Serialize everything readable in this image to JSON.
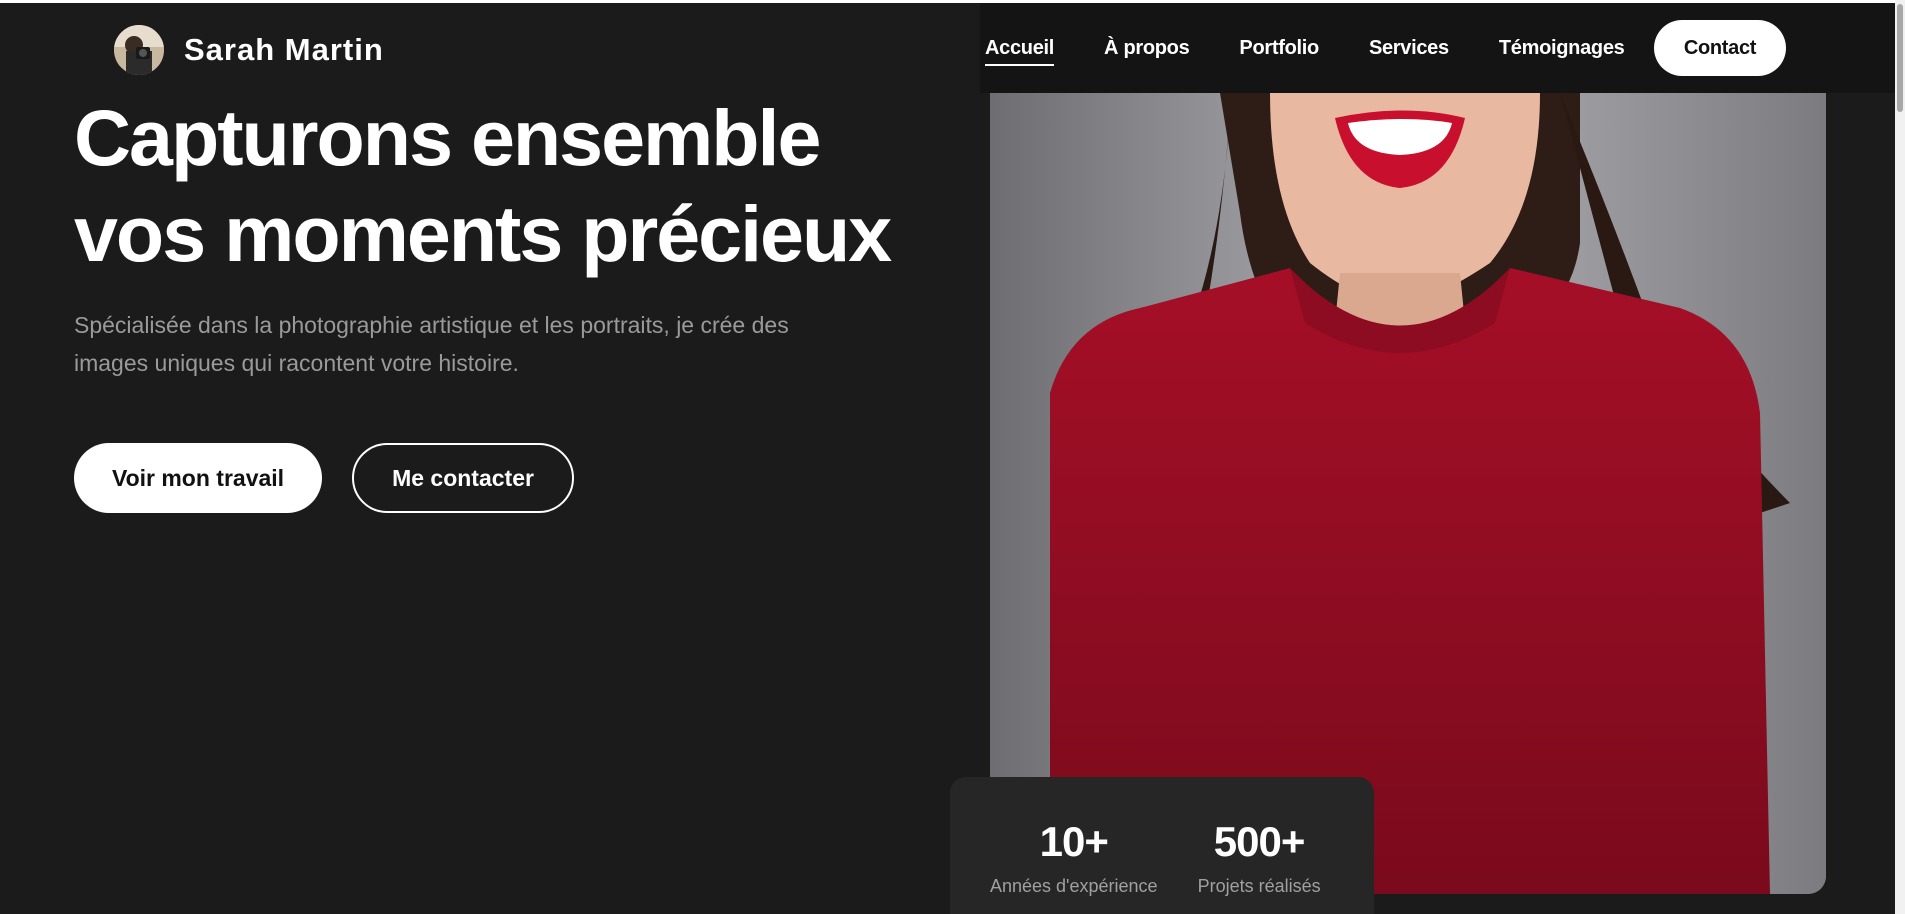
{
  "brand": {
    "name": "Sarah Martin",
    "avatar_icon": "camera-photographer-avatar"
  },
  "nav": {
    "items": [
      {
        "label": "Accueil",
        "active": true
      },
      {
        "label": "À propos"
      },
      {
        "label": "Portfolio"
      },
      {
        "label": "Services"
      },
      {
        "label": "Témoignages"
      }
    ],
    "contact_label": "Contact"
  },
  "hero": {
    "title_line1": "Capturons ensemble",
    "title_line2": "vos moments précieux",
    "subtitle_line1": "Spécialisée dans la photographie artistique et les portraits, je crée des",
    "subtitle_line2": "images uniques qui racontent votre histoire.",
    "primary_button": "Voir mon travail",
    "secondary_button": "Me contacter"
  },
  "stats": [
    {
      "value": "10+",
      "label": "Années d'expérience"
    },
    {
      "value": "500+",
      "label": "Projets réalisés"
    }
  ],
  "colors": {
    "background": "#1b1b1b",
    "text": "#ffffff",
    "muted_text": "#9a9a9a",
    "sweater": "#a50f27",
    "lips": "#c8102e"
  }
}
